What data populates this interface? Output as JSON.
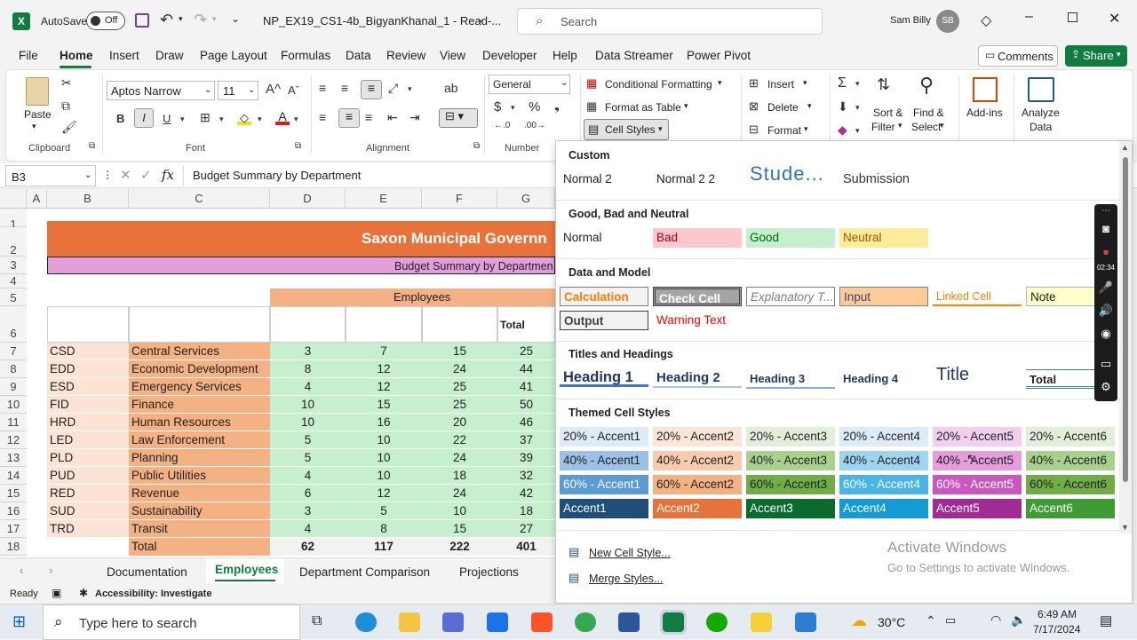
{
  "titlebar": {
    "autosave_label": "AutoSave",
    "autosave_state": "Off",
    "filename": "NP_EX19_CS1-4b_BigyanKhanal_1 - Read-...",
    "search_placeholder": "Search",
    "user_name": "Sam Billy",
    "user_initials": "SB"
  },
  "menu": [
    "File",
    "Home",
    "Insert",
    "Draw",
    "Page Layout",
    "Formulas",
    "Data",
    "Review",
    "View",
    "Developer",
    "Help",
    "Data Streamer",
    "Power Pivot"
  ],
  "comments_label": "Comments",
  "share_label": "Share",
  "ribbon": {
    "paste": "Paste",
    "clipboard": "Clipboard",
    "font_name": "Aptos Narrow",
    "font_size": "11",
    "font_group": "Font",
    "alignment_group": "Alignment",
    "number_format": "General",
    "number_group": "Number",
    "cond_format": "Conditional Formatting",
    "format_table": "Format as Table",
    "cell_styles": "Cell Styles",
    "insert": "Insert",
    "delete": "Delete",
    "format": "Format",
    "sort_filter_1": "Sort &",
    "sort_filter_2": "Filter",
    "find_select_1": "Find &",
    "find_select_2": "Select",
    "addins": "Add-ins",
    "analyze_1": "Analyze",
    "analyze_2": "Data",
    "bold": "B",
    "italic": "I",
    "underline": "U"
  },
  "formula": {
    "namebox": "B3",
    "fx": "fx",
    "content": "Budget Summary by Department"
  },
  "columns": [
    "A",
    "B",
    "C",
    "D",
    "E",
    "F",
    "G"
  ],
  "rows": [
    "1",
    "2",
    "3",
    "4",
    "5",
    "6",
    "7",
    "8",
    "9",
    "10",
    "11",
    "12",
    "13",
    "14",
    "15",
    "16",
    "17",
    "18"
  ],
  "sheet": {
    "title": "Saxon Municipal Governn",
    "subtitle": "Budget Summary by Departmen",
    "employees_header": "Employees",
    "total_header": "Total",
    "data": [
      {
        "code": "CSD",
        "name": "Central Services",
        "d": "3",
        "e": "7",
        "f": "15",
        "g": "25"
      },
      {
        "code": "EDD",
        "name": "Economic Development",
        "d": "8",
        "e": "12",
        "f": "24",
        "g": "44"
      },
      {
        "code": "ESD",
        "name": "Emergency Services",
        "d": "4",
        "e": "12",
        "f": "25",
        "g": "41"
      },
      {
        "code": "FID",
        "name": "Finance",
        "d": "10",
        "e": "15",
        "f": "25",
        "g": "50"
      },
      {
        "code": "HRD",
        "name": "Human Resources",
        "d": "10",
        "e": "16",
        "f": "20",
        "g": "46"
      },
      {
        "code": "LED",
        "name": "Law Enforcement",
        "d": "5",
        "e": "10",
        "f": "22",
        "g": "37"
      },
      {
        "code": "PLD",
        "name": "Planning",
        "d": "5",
        "e": "10",
        "f": "24",
        "g": "39"
      },
      {
        "code": "PUD",
        "name": "Public Utilities",
        "d": "4",
        "e": "10",
        "f": "18",
        "g": "32"
      },
      {
        "code": "RED",
        "name": "Revenue",
        "d": "6",
        "e": "12",
        "f": "24",
        "g": "42"
      },
      {
        "code": "SUD",
        "name": "Sustainability",
        "d": "3",
        "e": "5",
        "f": "10",
        "g": "18"
      },
      {
        "code": "TRD",
        "name": "Transit",
        "d": "4",
        "e": "8",
        "f": "15",
        "g": "27"
      }
    ],
    "total_row": {
      "label": "Total",
      "d": "62",
      "e": "117",
      "f": "222",
      "g": "401"
    }
  },
  "tabs": [
    "Documentation",
    "Employees",
    "Department Comparison",
    "Projections"
  ],
  "status": {
    "ready": "Ready",
    "accessibility": "Accessibility: Investigate"
  },
  "gallery": {
    "custom_header": "Custom",
    "custom": [
      "Normal 2",
      "Normal 2 2",
      "Stude...",
      "Submission"
    ],
    "gbn_header": "Good, Bad and Neutral",
    "gbn": [
      "Normal",
      "Bad",
      "Good",
      "Neutral"
    ],
    "dm_header": "Data and Model",
    "dm": [
      "Calculation",
      "Check Cell",
      "Explanatory T...",
      "Input",
      "Linked Cell",
      "Note",
      "Output",
      "Warning Text"
    ],
    "th_header": "Titles and Headings",
    "th": [
      "Heading 1",
      "Heading 2",
      "Heading 3",
      "Heading 4",
      "Title",
      "Total"
    ],
    "themed_header": "Themed Cell Styles",
    "r20": [
      "20% - Accent1",
      "20% - Accent2",
      "20% - Accent3",
      "20% - Accent4",
      "20% - Accent5",
      "20% - Accent6"
    ],
    "r40": [
      "40% - Accent1",
      "40% - Accent2",
      "40% - Accent3",
      "40% - Accent4",
      "40% - Accent5",
      "40% - Accent6"
    ],
    "r60": [
      "60% - Accent1",
      "60% - Accent2",
      "60% - Accent3",
      "60% - Accent4",
      "60% - Accent5",
      "60% - Accent6"
    ],
    "r100": [
      "Accent1",
      "Accent2",
      "Accent3",
      "Accent4",
      "Accent5",
      "Accent6"
    ],
    "new_style": "New Cell Style...",
    "merge_styles": "Merge Styles..."
  },
  "recorder_time": "02:34",
  "watermark": {
    "line1": "Activate Windows",
    "line2": "Go to Settings to activate Windows."
  },
  "taskbar": {
    "search_placeholder": "Type here to search",
    "temp": "30°C",
    "time": "6:49 AM",
    "date": "7/17/2024"
  },
  "colors": {
    "excel_green": "#107c41",
    "title_orange": "#e8733a",
    "subtitle_pink": "#e39fd9",
    "code_bg": "#fbe3d6",
    "name_bg": "#f4b183",
    "num_bg": "#c6efce",
    "header_bg": "#f4b183"
  }
}
